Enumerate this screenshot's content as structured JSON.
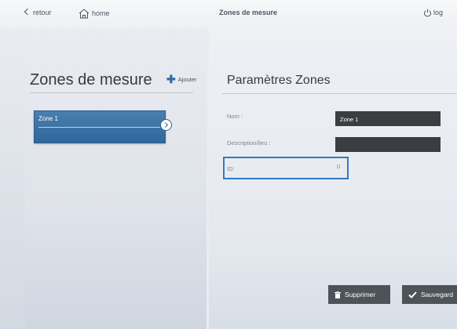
{
  "topbar": {
    "back_label": "retour",
    "home_label": "home",
    "title": "Zones de mesure",
    "logout_label": "log"
  },
  "left": {
    "heading": "Zones de mesure",
    "add_label": "Ajouter",
    "zones": [
      {
        "label": "Zone 1"
      }
    ]
  },
  "right": {
    "heading": "Paramètres Zones",
    "name_label": "Nom :",
    "name_value": "Zone 1",
    "desc_label": "Description/lieu :",
    "desc_value": "",
    "id_label": "ID:",
    "id_value": "0"
  },
  "buttons": {
    "delete_label": "Supprimer",
    "save_label": "Sauvegard"
  },
  "colors": {
    "accent": "#2f6da4",
    "input_bg": "#3b3d40",
    "button_bg": "#4e5359",
    "highlight_border": "#2f7bc4"
  }
}
